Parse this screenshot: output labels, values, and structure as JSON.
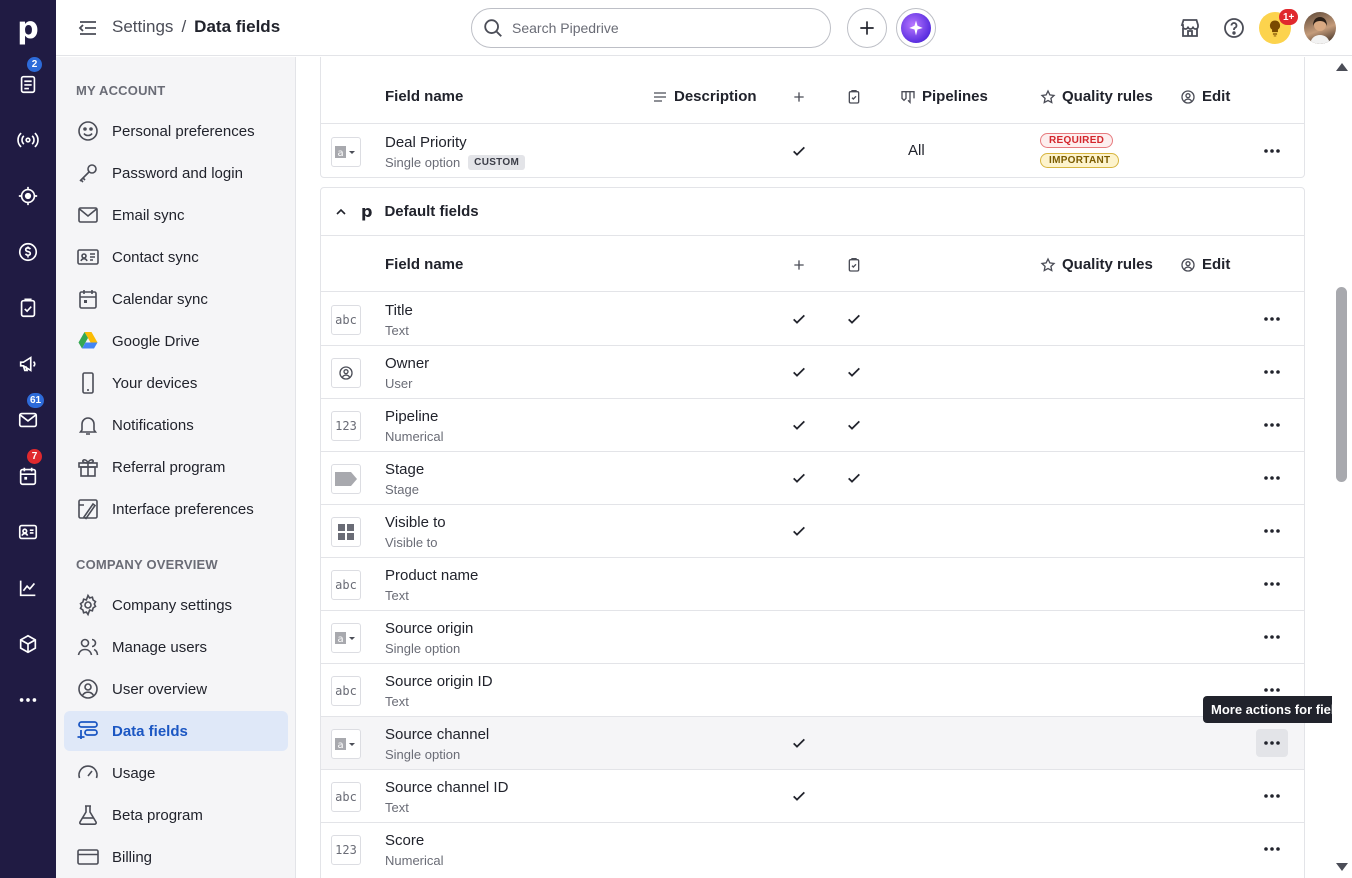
{
  "app": {
    "logo": "p",
    "breadcrumb": {
      "parent": "Settings",
      "separator": "/",
      "current": "Data fields"
    },
    "search": {
      "placeholder": "Search Pipedrive",
      "value": ""
    },
    "notifications_badge": "1+"
  },
  "rail": {
    "items": [
      {
        "name": "leads-icon",
        "badge": "2",
        "badge_color": "#2d6bd9"
      },
      {
        "name": "deals-icon",
        "badge": ""
      },
      {
        "name": "insights-icon",
        "badge": ""
      },
      {
        "name": "revenue-icon",
        "badge": ""
      },
      {
        "name": "activities-icon",
        "badge": ""
      },
      {
        "name": "campaigns-icon",
        "badge": ""
      },
      {
        "name": "mail-icon",
        "badge": "61",
        "badge_color": "#2d6bd9"
      },
      {
        "name": "calendar-icon",
        "badge": "7",
        "badge_color": "#e0292e"
      },
      {
        "name": "contacts-icon",
        "badge": ""
      },
      {
        "name": "reports-icon",
        "badge": ""
      },
      {
        "name": "products-icon",
        "badge": ""
      },
      {
        "name": "more-icon",
        "badge": ""
      }
    ]
  },
  "sidebar": {
    "my_account_title": "MY ACCOUNT",
    "my_account": [
      {
        "label": "Personal preferences",
        "icon": "smile-icon"
      },
      {
        "label": "Password and login",
        "icon": "key-icon"
      },
      {
        "label": "Email sync",
        "icon": "envelope-icon"
      },
      {
        "label": "Contact sync",
        "icon": "contact-card-icon"
      },
      {
        "label": "Calendar sync",
        "icon": "calendar-sync-icon"
      },
      {
        "label": "Google Drive",
        "icon": "google-drive-icon"
      },
      {
        "label": "Your devices",
        "icon": "phone-icon"
      },
      {
        "label": "Notifications",
        "icon": "bell-icon"
      },
      {
        "label": "Referral program",
        "icon": "gift-icon"
      },
      {
        "label": "Interface preferences",
        "icon": "interface-icon"
      }
    ],
    "company_title": "COMPANY OVERVIEW",
    "company": [
      {
        "label": "Company settings",
        "icon": "gear-icon"
      },
      {
        "label": "Manage users",
        "icon": "users-icon"
      },
      {
        "label": "User overview",
        "icon": "user-circle-icon"
      },
      {
        "label": "Data fields",
        "icon": "data-fields-icon",
        "active": true
      },
      {
        "label": "Usage",
        "icon": "gauge-icon"
      },
      {
        "label": "Beta program",
        "icon": "flask-icon"
      },
      {
        "label": "Billing",
        "icon": "credit-card-icon"
      }
    ]
  },
  "custom_table": {
    "headers": {
      "field_name": "Field name",
      "description": "Description",
      "pipelines": "Pipelines",
      "quality_rules": "Quality rules",
      "edit": "Edit"
    },
    "rows": [
      {
        "name": "Deal Priority",
        "type": "Single option",
        "tag": "CUSTOM",
        "pipelines": "All",
        "rules": [
          "REQUIRED",
          "IMPORTANT"
        ]
      }
    ]
  },
  "default_table": {
    "group_title": "Default fields",
    "headers": {
      "field_name": "Field name",
      "quality_rules": "Quality rules",
      "edit": "Edit"
    },
    "rows": [
      {
        "name": "Title",
        "type": "Text",
        "icon": "abc",
        "add": true,
        "detail": true
      },
      {
        "name": "Owner",
        "type": "User",
        "icon": "user",
        "add": true,
        "detail": true
      },
      {
        "name": "Pipeline",
        "type": "Numerical",
        "icon": "123",
        "add": true,
        "detail": true
      },
      {
        "name": "Stage",
        "type": "Stage",
        "icon": "stage",
        "add": true,
        "detail": true
      },
      {
        "name": "Visible to",
        "type": "Visible to",
        "icon": "grid",
        "add": true,
        "detail": false
      },
      {
        "name": "Product name",
        "type": "Text",
        "icon": "abc",
        "add": false,
        "detail": false
      },
      {
        "name": "Source origin",
        "type": "Single option",
        "icon": "option",
        "add": false,
        "detail": false
      },
      {
        "name": "Source origin ID",
        "type": "Text",
        "icon": "abc",
        "add": false,
        "detail": false
      },
      {
        "name": "Source channel",
        "type": "Single option",
        "icon": "option",
        "add": true,
        "detail": false,
        "hover": true
      },
      {
        "name": "Source channel ID",
        "type": "Text",
        "icon": "abc",
        "add": true,
        "detail": false
      },
      {
        "name": "Score",
        "type": "Numerical",
        "icon": "123",
        "add": false,
        "detail": false
      }
    ]
  },
  "tooltip": "More actions for field"
}
